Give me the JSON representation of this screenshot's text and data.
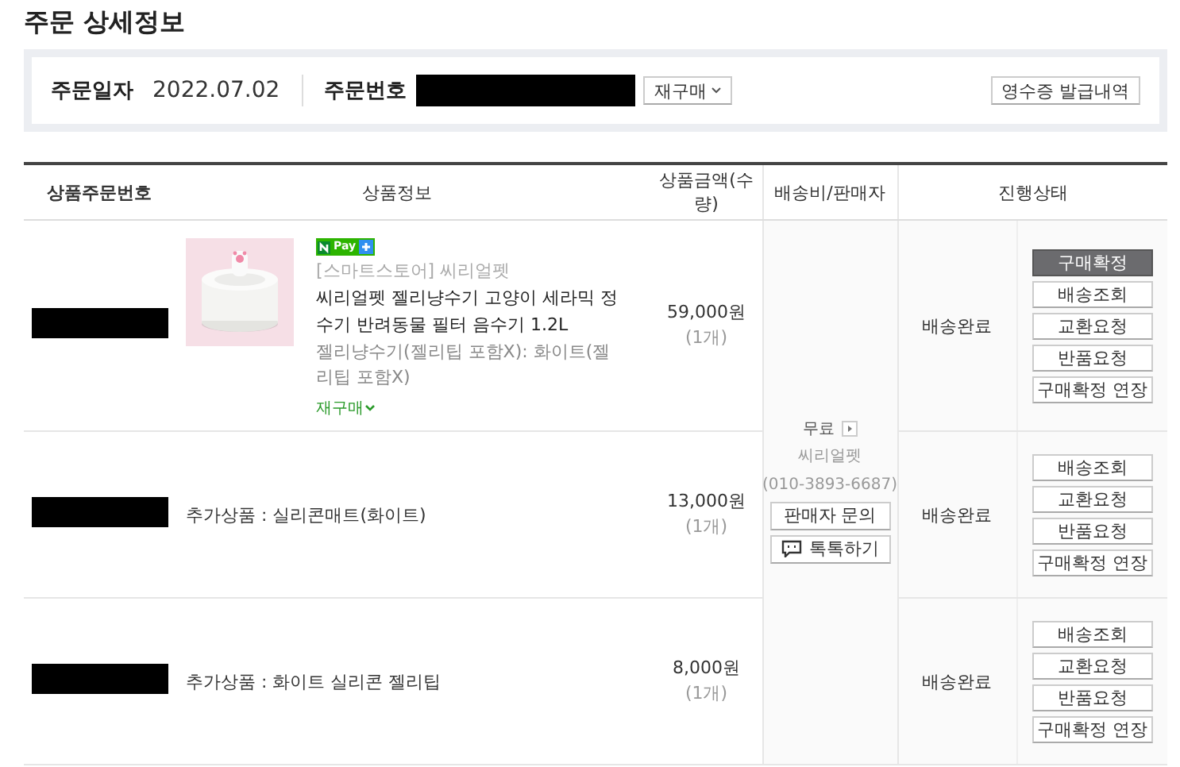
{
  "page_title": "주문 상세정보",
  "order_info": {
    "date_label": "주문일자",
    "date": "2022.07.02",
    "number_label": "주문번호",
    "reorder_button": "재구매",
    "receipt_button": "영수증 발급내역"
  },
  "table": {
    "columns": [
      "상품주문번호",
      "상품정보",
      "상품금액(수량)",
      "배송비/판매자",
      "진행상태"
    ],
    "shipping": {
      "fee": "무료",
      "seller": "씨리얼펫",
      "phone": "(010-3893-6687)",
      "inquiry_button": "판매자 문의",
      "talk_button": "톡톡하기"
    },
    "rows": [
      {
        "kind": "main",
        "badge": "Pay",
        "store": "[스마트스토어] 씨리얼펫",
        "name": "씨리얼펫 젤리냥수기 고양이 세라믹 정수기 반려동물 필터 음수기 1.2L",
        "option": "젤리냥수기(젤리팁 포함X): 화이트(젤리팁 포함X)",
        "reorder_link": "재구매",
        "price": "59,000원",
        "quantity": "(1개)",
        "status": "배송완료",
        "actions": [
          {
            "label": "구매확정",
            "primary": true
          },
          {
            "label": "배송조회",
            "primary": false
          },
          {
            "label": "교환요청",
            "primary": false
          },
          {
            "label": "반품요청",
            "primary": false
          },
          {
            "label": "구매확정 연장",
            "primary": false
          }
        ]
      },
      {
        "kind": "addon",
        "name": "추가상품 : 실리콘매트(화이트)",
        "price": "13,000원",
        "quantity": "(1개)",
        "status": "배송완료",
        "actions": [
          {
            "label": "배송조회",
            "primary": false
          },
          {
            "label": "교환요청",
            "primary": false
          },
          {
            "label": "반품요청",
            "primary": false
          },
          {
            "label": "구매확정 연장",
            "primary": false
          }
        ]
      },
      {
        "kind": "addon",
        "name": "추가상품 : 화이트 실리콘 젤리팁",
        "price": "8,000원",
        "quantity": "(1개)",
        "status": "배송완료",
        "actions": [
          {
            "label": "배송조회",
            "primary": false
          },
          {
            "label": "교환요청",
            "primary": false
          },
          {
            "label": "반품요청",
            "primary": false
          },
          {
            "label": "구매확정 연장",
            "primary": false
          }
        ]
      }
    ]
  }
}
